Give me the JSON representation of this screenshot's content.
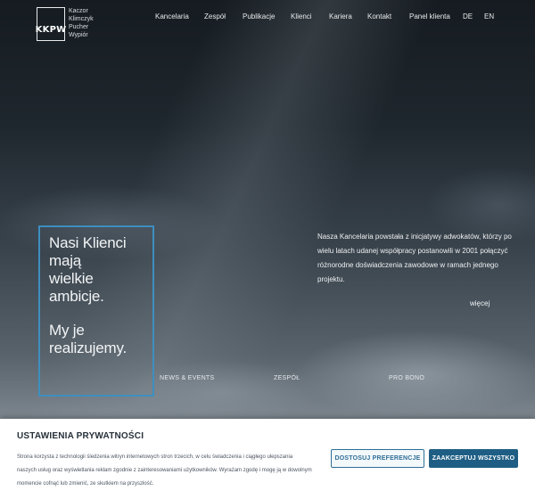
{
  "logo": {
    "mark": "KKPW",
    "names": [
      "Kaczor",
      "Klimczyk",
      "Pucher",
      "Wypiór"
    ]
  },
  "nav": {
    "items": [
      {
        "label": "Kancelaria"
      },
      {
        "label": "Zespół"
      },
      {
        "label": "Publikacje"
      },
      {
        "label": "Klienci"
      },
      {
        "label": "Kariera"
      },
      {
        "label": "Kontakt"
      },
      {
        "label": "Panel klienta"
      },
      {
        "label": "DE"
      },
      {
        "label": "EN"
      }
    ]
  },
  "hero": {
    "headline_lines": [
      "Nasi Klienci",
      "mają",
      "wielkie",
      "ambicje."
    ],
    "headline_lines_2": [
      "My je",
      "realizujemy."
    ],
    "intro": "Nasza Kancelaria powstała z inicjatywy adwokatów, którzy po wielu latach udanej współpracy postanowili w 2001 połączyć różnorodne doświadczenia zawodowe w ramach jednego projektu.",
    "more_link": "więcej"
  },
  "quick_links": [
    "NEWS & EVENTS",
    "ZESPÓŁ",
    "PRO BONO"
  ],
  "cookie": {
    "title": "USTAWIENIA PRYWATNOŚCI",
    "text": "Strona korzysta z technologii śledzenia witryn internetowych stron trzecich, w celu świadczenia i ciągłego ulepszania naszych usług oraz wyświetlania reklam zgodnie z zainteresowaniami użytkowników. Wyrażam zgodę i mogę ją w dowolnym momencie cofnąć lub zmienić, ze skutkiem na przyszłość.",
    "pref_button": "DOSTOSUJ PREFERENCJE",
    "accept_button": "ZAAKCEPTUJ WSZYSTKO"
  },
  "colors": {
    "accent_border": "#3d8fbf",
    "button_primary": "#1f5e84"
  }
}
